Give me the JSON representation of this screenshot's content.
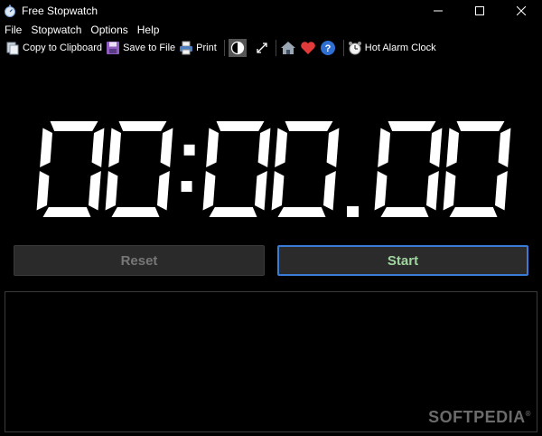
{
  "window": {
    "title": "Free Stopwatch"
  },
  "menu": [
    "File",
    "Stopwatch",
    "Options",
    "Help"
  ],
  "toolbar": {
    "copy_label": "Copy to Clipboard",
    "save_label": "Save to File",
    "print_label": "Print",
    "alarm_label": "Hot Alarm Clock"
  },
  "display": {
    "time": "00:00.00"
  },
  "buttons": {
    "reset_label": "Reset",
    "start_label": "Start"
  },
  "watermark": {
    "text": "SOFTPEDIA"
  },
  "colors": {
    "background": "#000000",
    "digits": "#ffffff",
    "start_text": "#9fd59f",
    "start_border": "#3a7bd5",
    "reset_text": "#777777",
    "heart": "#e03a3a",
    "help": "#2f6fd1"
  },
  "icons": [
    "stopwatch-icon",
    "minimize-icon",
    "maximize-icon",
    "close-icon",
    "clipboard-icon",
    "save-icon",
    "print-icon",
    "contrast-icon",
    "expand-icon",
    "home-icon",
    "heart-icon",
    "help-icon",
    "alarm-clock-icon"
  ]
}
